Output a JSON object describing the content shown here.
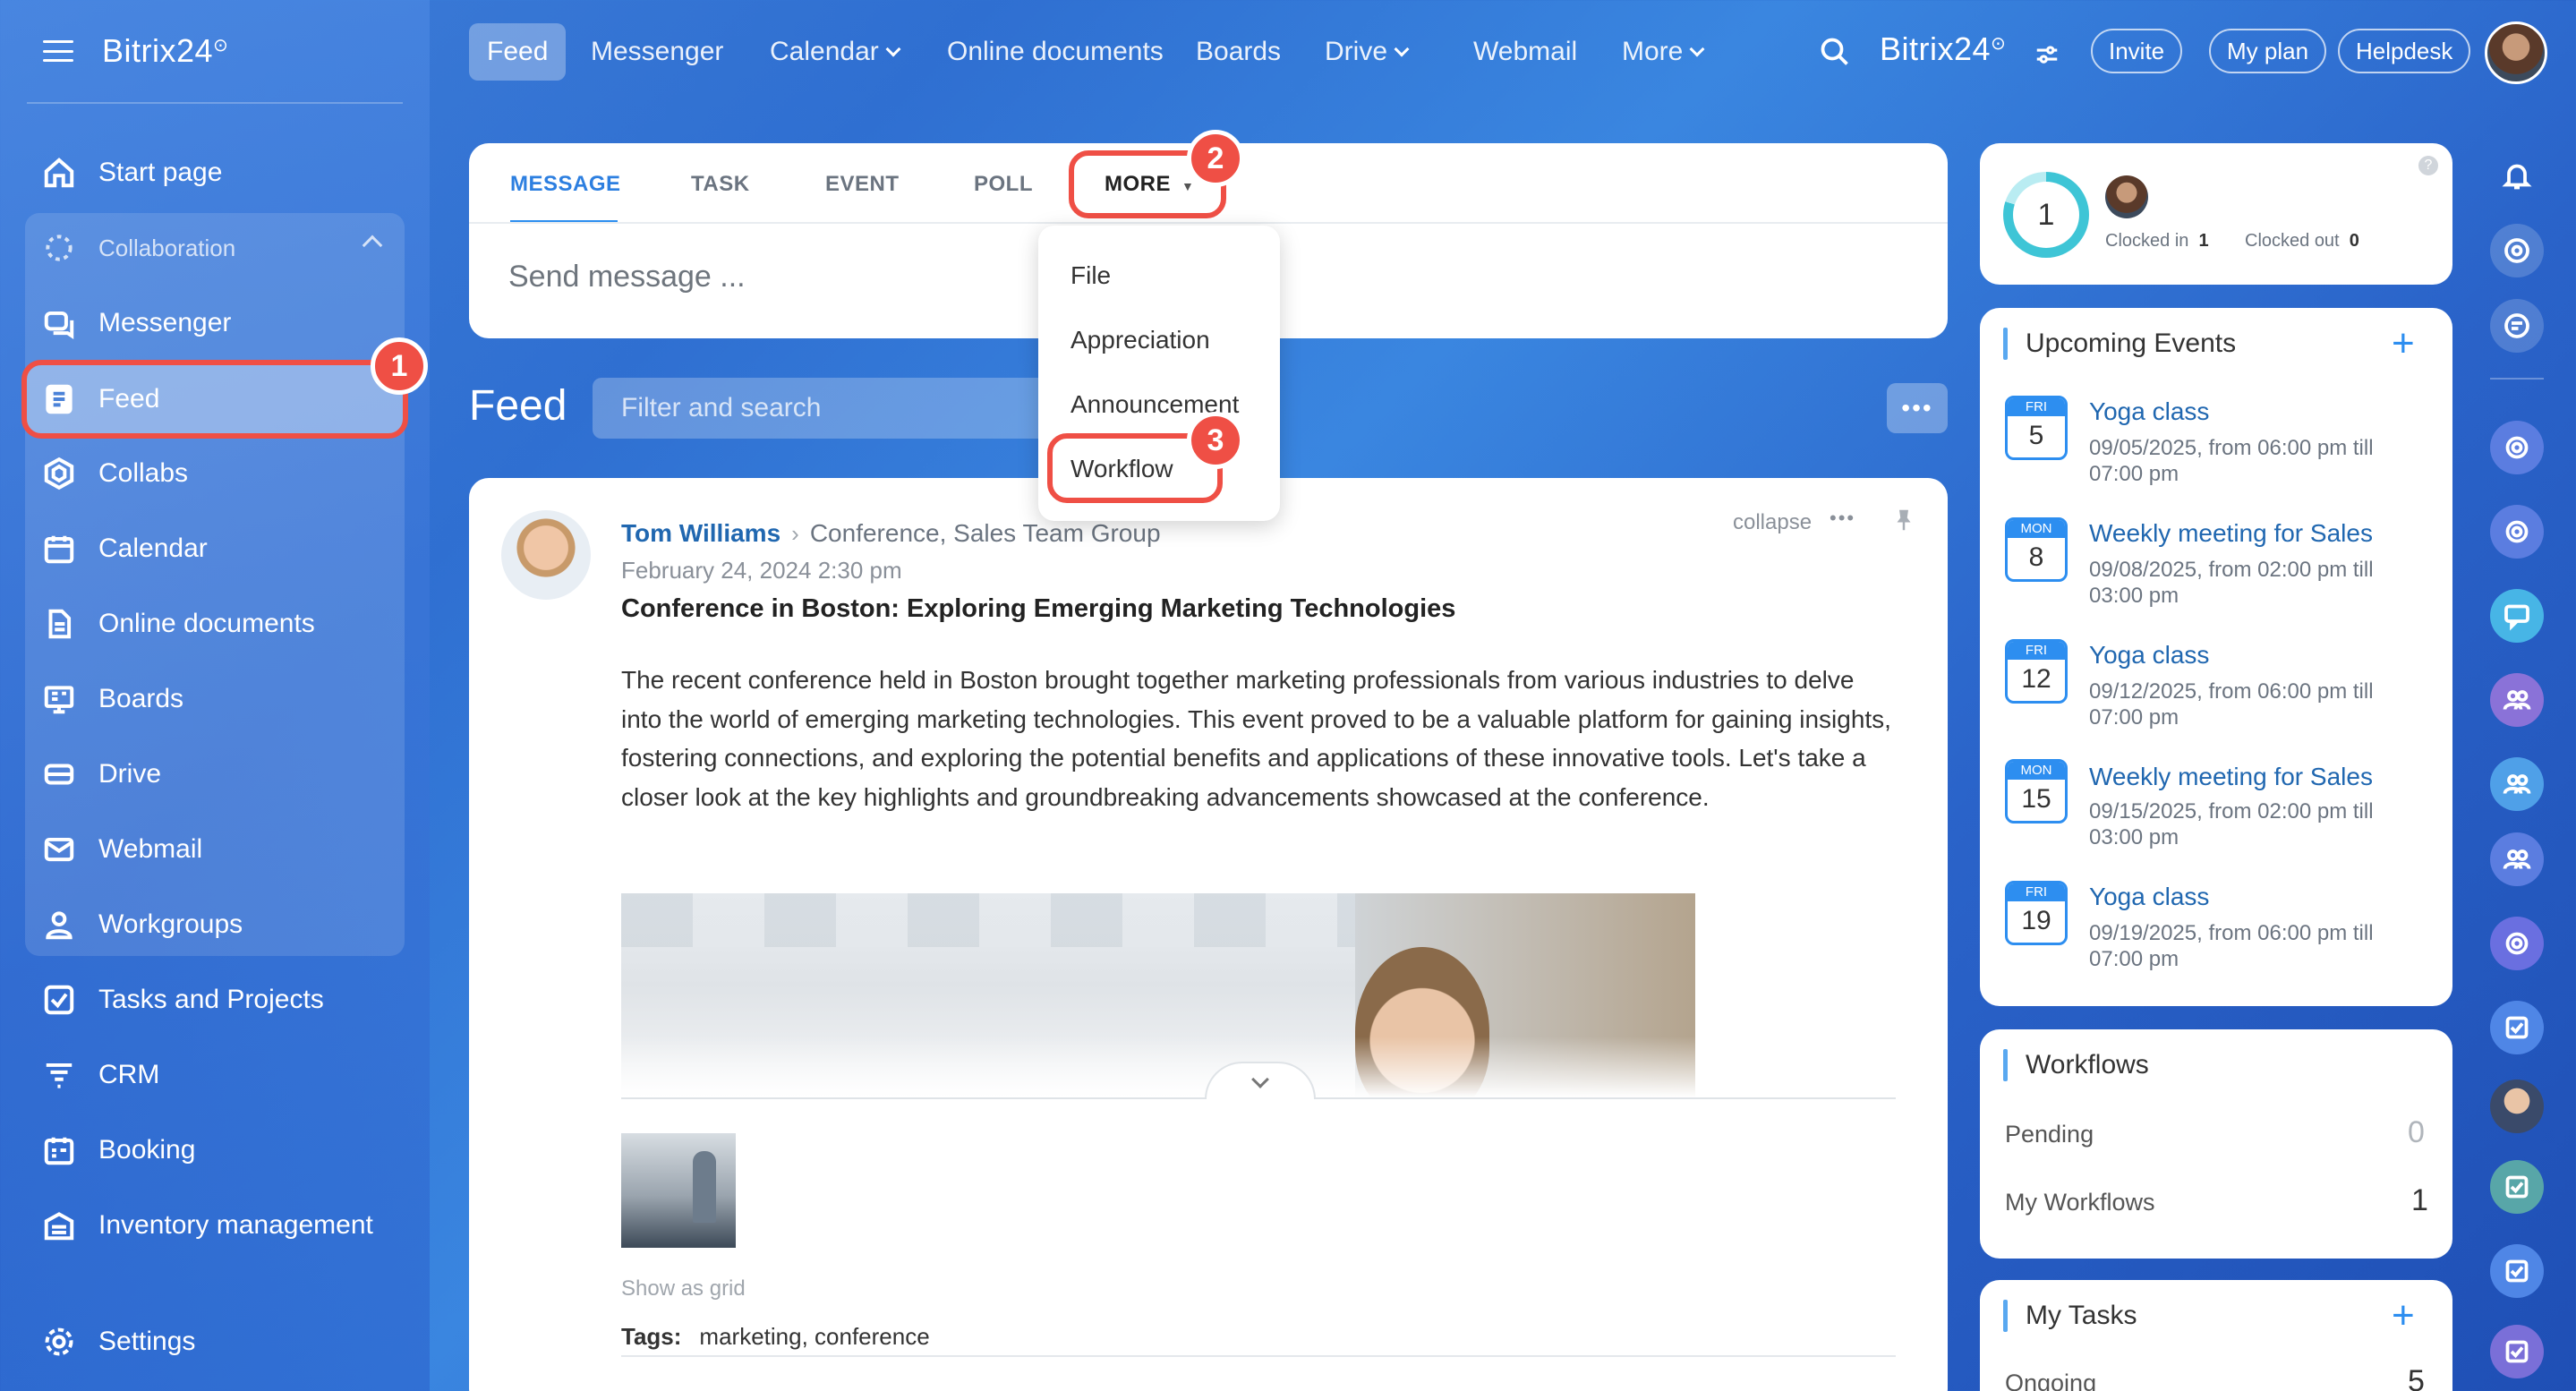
{
  "sidebar": {
    "brand": "Bitrix24",
    "items": [
      {
        "label": "Start page"
      },
      {
        "label": "Collaboration"
      },
      {
        "label": "Messenger"
      },
      {
        "label": "Feed"
      },
      {
        "label": "Collabs"
      },
      {
        "label": "Calendar"
      },
      {
        "label": "Online documents"
      },
      {
        "label": "Boards"
      },
      {
        "label": "Drive"
      },
      {
        "label": "Webmail"
      },
      {
        "label": "Workgroups"
      },
      {
        "label": "Tasks and Projects"
      },
      {
        "label": "CRM"
      },
      {
        "label": "Booking"
      },
      {
        "label": "Inventory management"
      },
      {
        "label": "Settings"
      }
    ]
  },
  "topnav": {
    "items": [
      "Feed",
      "Messenger",
      "Calendar",
      "Online documents",
      "Boards",
      "Drive",
      "Webmail",
      "More"
    ],
    "brand": "Bitrix24",
    "invite": "Invite",
    "myplan": "My plan",
    "helpdesk": "Helpdesk"
  },
  "composer": {
    "tabs": [
      "MESSAGE",
      "TASK",
      "EVENT",
      "POLL",
      "MORE"
    ],
    "placeholder": "Send message ..."
  },
  "more_menu": [
    "File",
    "Appreciation",
    "Announcement",
    "Workflow"
  ],
  "callouts": [
    "1",
    "2",
    "3"
  ],
  "feed": {
    "title": "Feed",
    "filter_placeholder": "Filter and search"
  },
  "post": {
    "author": "Tom Williams",
    "target": "Conference, Sales Team Group",
    "date": "February 24, 2024 2:30 pm",
    "collapse": "collapse",
    "title": "Conference in Boston: Exploring Emerging Marketing Technologies",
    "body": "The recent conference held in Boston brought together marketing professionals from various industries to delve into the world of emerging marketing technologies. This event proved to be a valuable platform for gaining insights, fostering connections, and exploring the potential benefits and applications of these innovative tools. Let's take a closer look at the key highlights and groundbreaking advancements showcased at the conference.",
    "show_grid": "Show as grid",
    "tags_label": "Tags:",
    "tags": [
      "marketing",
      "conference"
    ]
  },
  "timeman": {
    "count": "1",
    "clocked_in_label": "Clocked in",
    "clocked_in": "1",
    "clocked_out_label": "Clocked out",
    "clocked_out": "0"
  },
  "events": {
    "title": "Upcoming Events",
    "items": [
      {
        "day": "FRI",
        "num": "5",
        "title": "Yoga class",
        "time": "09/05/2025, from 06:00 pm till 07:00 pm"
      },
      {
        "day": "MON",
        "num": "8",
        "title": "Weekly meeting for Sales",
        "time": "09/08/2025, from 02:00 pm till 03:00 pm"
      },
      {
        "day": "FRI",
        "num": "12",
        "title": "Yoga class",
        "time": "09/12/2025, from 06:00 pm till 07:00 pm"
      },
      {
        "day": "MON",
        "num": "15",
        "title": "Weekly meeting for Sales",
        "time": "09/15/2025, from 02:00 pm till 03:00 pm"
      },
      {
        "day": "FRI",
        "num": "19",
        "title": "Yoga class",
        "time": "09/19/2025, from 06:00 pm till 07:00 pm"
      }
    ]
  },
  "workflows": {
    "title": "Workflows",
    "pending_label": "Pending",
    "pending": "0",
    "mine_label": "My Workflows",
    "mine": "1"
  },
  "tasks": {
    "title": "My Tasks",
    "ongoing_label": "Ongoing",
    "ongoing": "5"
  },
  "colors": {
    "accent": "#2d8ef0",
    "highlight": "#ef4f45",
    "link": "#2067b0"
  }
}
